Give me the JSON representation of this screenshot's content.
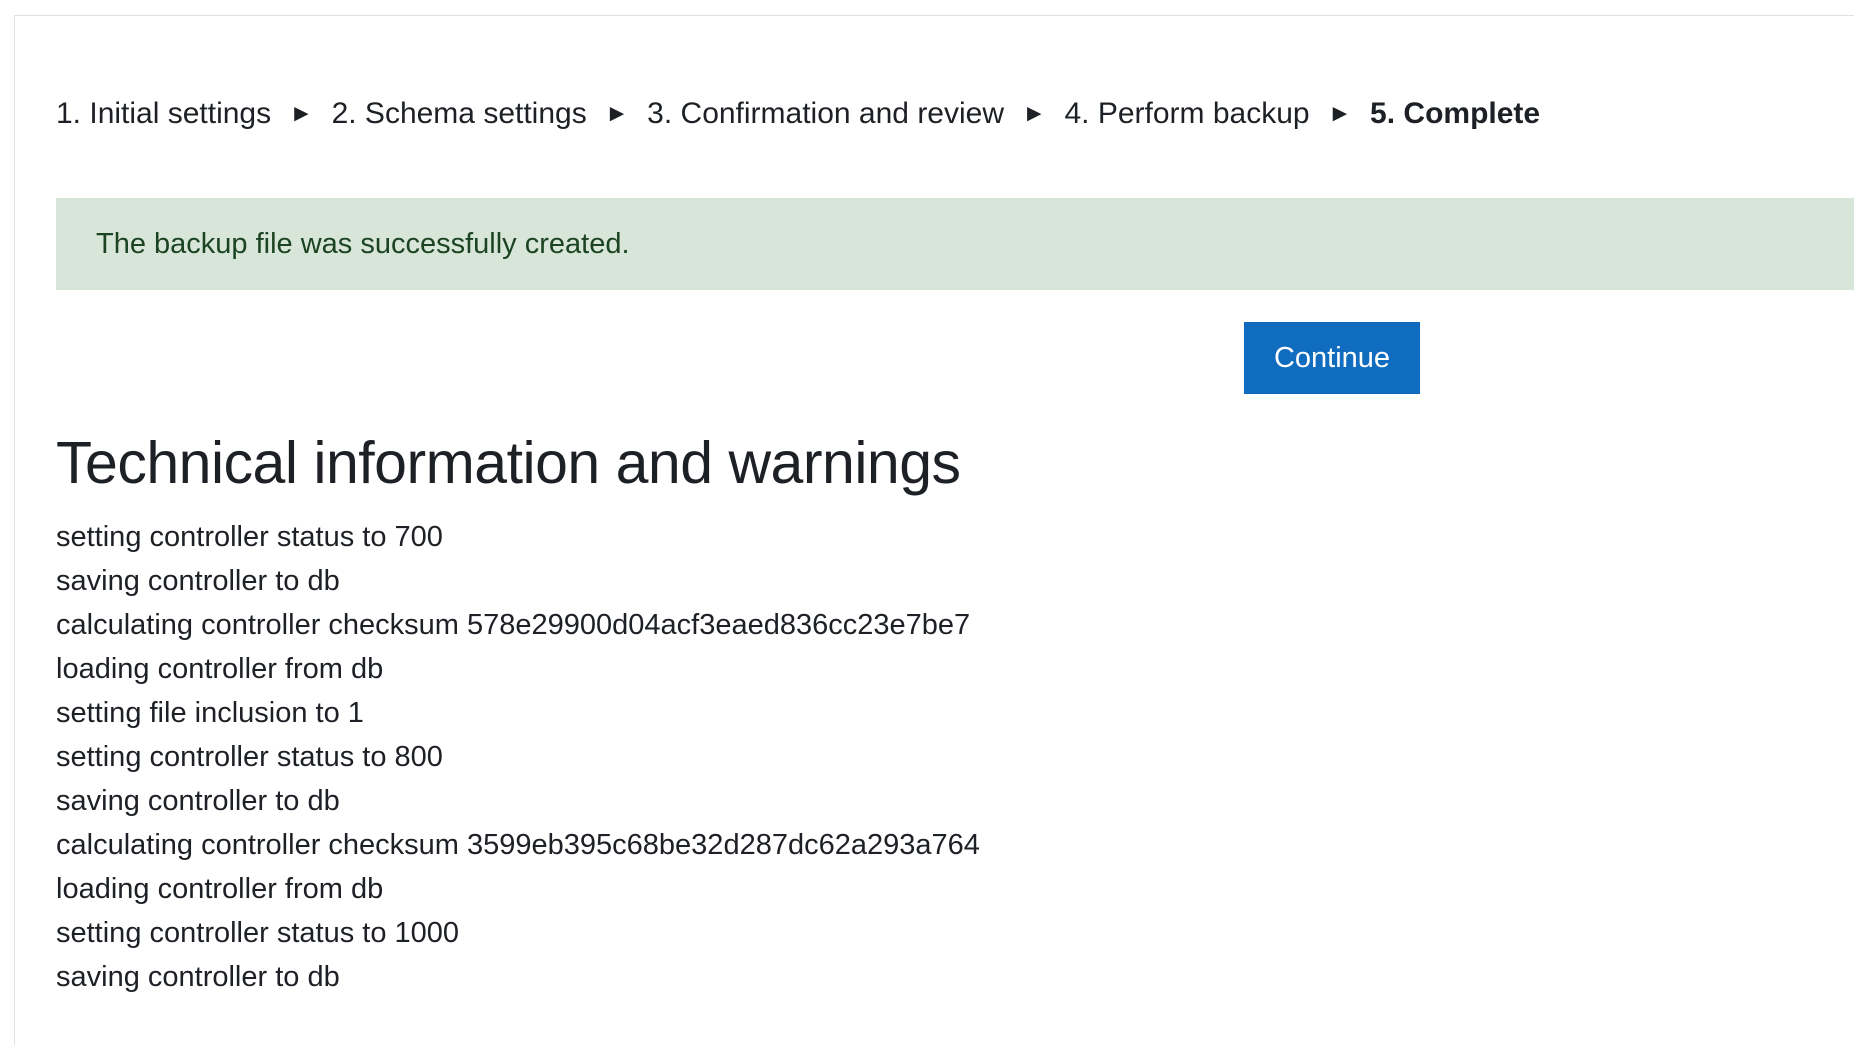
{
  "progress": {
    "steps": [
      "1. Initial settings",
      "2. Schema settings",
      "3. Confirmation and review",
      "4. Perform backup",
      "5. Complete"
    ],
    "separator": "►"
  },
  "alert": {
    "message": "The backup file was successfully created."
  },
  "actions": {
    "continue_label": "Continue"
  },
  "technical": {
    "heading": "Technical information and warnings",
    "log_lines": [
      "setting controller status to 700",
      "saving controller to db",
      "calculating controller checksum 578e29900d04acf3eaed836cc23e7be7",
      "loading controller from db",
      "setting file inclusion to 1",
      "setting controller status to 800",
      "saving controller to db",
      "calculating controller checksum 3599eb395c68be32d287dc62a293a764",
      "loading controller from db",
      "setting controller status to 1000",
      "saving controller to db"
    ]
  },
  "colors": {
    "primary_button": "#0f6cbf",
    "success_background": "#d8e6d9",
    "success_text": "#1c4322",
    "body_text": "#1d2125"
  }
}
